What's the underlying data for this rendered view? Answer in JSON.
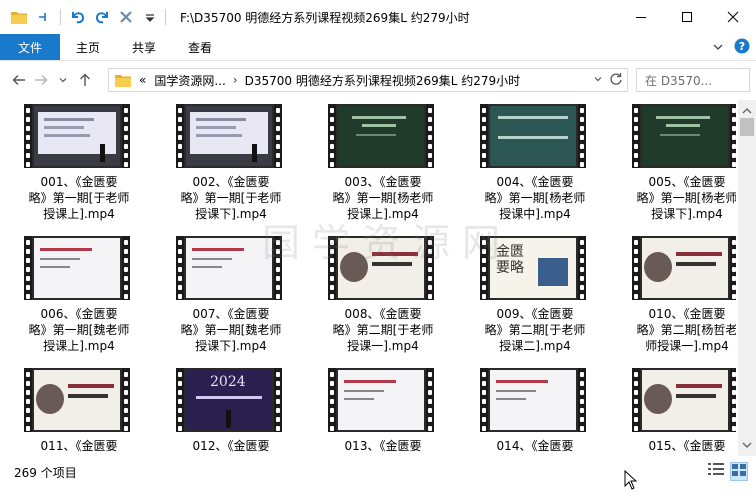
{
  "window": {
    "title": "F:\\D35700 明德经方系列课程视频269集L 约279小时"
  },
  "ribbon": {
    "tabs": [
      "文件",
      "主页",
      "共享",
      "查看"
    ]
  },
  "address": {
    "crumbs": [
      "国学资源网...",
      "D35700 明德经方系列课程视频269集L 约279小时"
    ],
    "search_placeholder": "在 D3570..."
  },
  "items": [
    {
      "name": "001、《金匮要略》第一期[于老师授课上].mp4",
      "lines": [
        "001、《金匮要",
        "略》第一期[于老师",
        "授课上].mp4"
      ],
      "style": "hall"
    },
    {
      "name": "002、《金匮要略》第一期[于老师授课下].mp4",
      "lines": [
        "002、《金匮要",
        "略》第一期[于老师",
        "授课下].mp4"
      ],
      "style": "hall"
    },
    {
      "name": "003、《金匮要略》第一期[杨老师授课上].mp4",
      "lines": [
        "003、《金匮要",
        "略》第一期[杨老师",
        "授课上].mp4"
      ],
      "style": "green"
    },
    {
      "name": "004、《金匮要略》第一期[杨老师授课中].mp4",
      "lines": [
        "004、《金匮要",
        "略》第一期[杨老师",
        "授课中].mp4"
      ],
      "style": "teal"
    },
    {
      "name": "005、《金匮要略》第一期[杨老师授课下].mp4",
      "lines": [
        "005、《金匮要",
        "略》第一期[杨老师",
        "授课下].mp4"
      ],
      "style": "green"
    },
    {
      "name": "006、《金匮要略》第一期[魏老师授课上].mp4",
      "lines": [
        "006、《金匮要",
        "略》第一期[魏老师",
        "授课上].mp4"
      ],
      "style": "white"
    },
    {
      "name": "007、《金匮要略》第一期[魏老师授课下].mp4",
      "lines": [
        "007、《金匮要",
        "略》第一期[魏老师",
        "授课下].mp4"
      ],
      "style": "white"
    },
    {
      "name": "008、《金匮要略》第二期[于老师授课一].mp4",
      "lines": [
        "008、《金匮要",
        "略》第二期[于老师",
        "授课一].mp4"
      ],
      "style": "ink"
    },
    {
      "name": "009、《金匮要略》第二期[于老师授课二].mp4",
      "lines": [
        "009、《金匮要",
        "略》第二期[于老师",
        "授课二].mp4"
      ],
      "style": "paper"
    },
    {
      "name": "010、《金匮要略》第二期[杨哲老师授课一].mp4",
      "lines": [
        "010、《金匮要",
        "略》第二期[杨哲老",
        "师授课一].mp4"
      ],
      "style": "ink"
    },
    {
      "name": "011、《金匮要",
      "lines": [
        "011、《金匮要"
      ],
      "style": "ink"
    },
    {
      "name": "012、《金匮要",
      "lines": [
        "012、《金匮要"
      ],
      "style": "purple"
    },
    {
      "name": "013、《金匮要",
      "lines": [
        "013、《金匮要"
      ],
      "style": "white"
    },
    {
      "name": "014、《金匮要",
      "lines": [
        "014、《金匮要"
      ],
      "style": "white"
    },
    {
      "name": "015、《金匮要",
      "lines": [
        "015、《金匮要"
      ],
      "style": "ink"
    }
  ],
  "thumb_texts": {
    "hall_lecture": "2024.3.6",
    "title_2024": "2024",
    "case_title": "思师临床验案精讲",
    "case_date": "2024.03",
    "jingui": "金匮要略",
    "jingui_title": "金匮",
    "jingui_sub": "要略"
  },
  "watermark": "国学资源网",
  "status": {
    "count": "269 个项目"
  },
  "colors": {
    "accent": "#1979ca",
    "hall": "#e8e6f2",
    "green": "#1f3a2a",
    "teal": "#2f5a55"
  }
}
